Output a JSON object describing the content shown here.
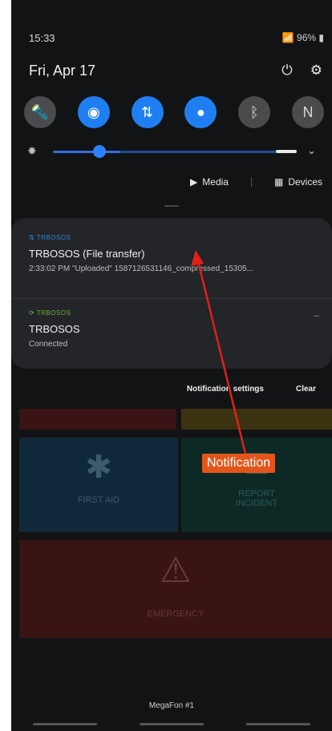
{
  "status_bar": {
    "time": "15:33",
    "indicators": "96%"
  },
  "date": "Fri, Apr 17",
  "quick_tiles": [
    {
      "name": "flashlight",
      "glyph": "🔦",
      "on": false
    },
    {
      "name": "wifi",
      "glyph": "◉",
      "on": true
    },
    {
      "name": "mobile-data",
      "glyph": "⇅",
      "on": true
    },
    {
      "name": "location",
      "glyph": "●",
      "on": true
    },
    {
      "name": "bluetooth",
      "glyph": "ᛒ",
      "on": false
    },
    {
      "name": "nfc",
      "glyph": "N",
      "on": false
    }
  ],
  "brightness_level": 0.3,
  "media_row": {
    "media_label": "Media",
    "devices_label": "Devices"
  },
  "notifications": [
    {
      "app": "TRBOSOS",
      "title": "TRBOSOS (File transfer)",
      "text": "2:33:02 PM \"Uploaded\" 1587126531146_compressed_15305..."
    },
    {
      "app": "TRBOSOS",
      "title": "TRBOSOS",
      "text": "Connected"
    }
  ],
  "footer_actions": {
    "settings": "Notification settings",
    "clear": "Clear"
  },
  "background_app": {
    "first_aid": "FIRST AID",
    "report_incident": "REPORT\nINCIDENT",
    "emergency": "EMERGENCY"
  },
  "carrier": "MegaFon #1",
  "annotation": {
    "label": "Notification",
    "color": "#e2561b"
  }
}
